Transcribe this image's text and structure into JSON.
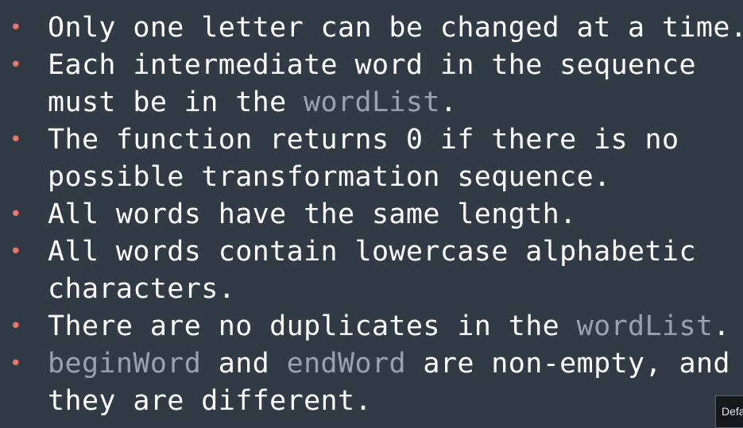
{
  "bullets": [
    {
      "lines": [
        [
          {
            "text": "Only one letter can be changed at a time."
          }
        ]
      ]
    },
    {
      "lines": [
        [
          {
            "text": "Each intermediate word in the sequence"
          }
        ],
        [
          {
            "text": "must be in the "
          },
          {
            "text": "wordList",
            "code": true
          },
          {
            "text": "."
          }
        ]
      ]
    },
    {
      "lines": [
        [
          {
            "text": "The function returns 0 if there is no"
          }
        ],
        [
          {
            "text": "possible transformation sequence."
          }
        ]
      ]
    },
    {
      "lines": [
        [
          {
            "text": "All words have the same length."
          }
        ]
      ]
    },
    {
      "lines": [
        [
          {
            "text": "All words contain lowercase alphabetic"
          }
        ],
        [
          {
            "text": "characters."
          }
        ]
      ]
    },
    {
      "lines": [
        [
          {
            "text": "There are no duplicates in the "
          },
          {
            "text": "wordList",
            "code": true
          },
          {
            "text": "."
          }
        ]
      ]
    },
    {
      "lines": [
        [
          {
            "text": "beginWord",
            "code": true
          },
          {
            "text": " and "
          },
          {
            "text": "endWord",
            "code": true
          },
          {
            "text": " are non-empty, and"
          }
        ],
        [
          {
            "text": "they are different."
          }
        ]
      ]
    }
  ],
  "bullet_glyph": "•",
  "corner_button": {
    "label": "Defa"
  },
  "colors": {
    "background": "#323a46",
    "text": "#ffffff",
    "code_text": "#9aa3ad",
    "bullet": "#e8766a"
  }
}
